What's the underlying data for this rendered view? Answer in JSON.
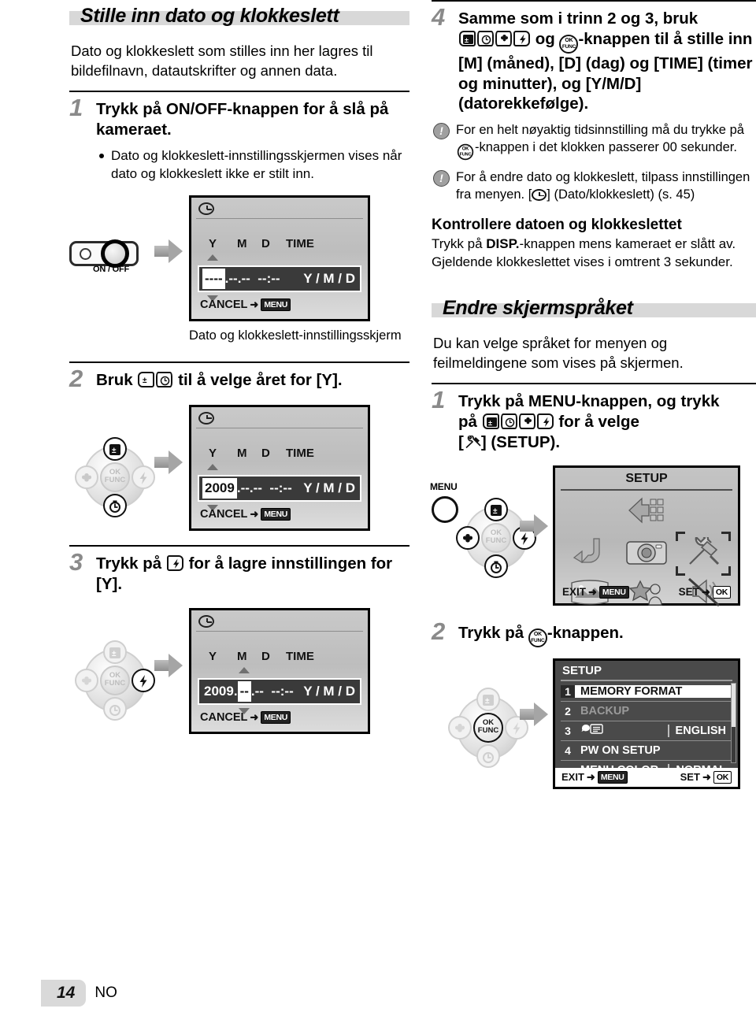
{
  "page": {
    "number": "14",
    "locale": "NO"
  },
  "left": {
    "section_title": "Stille inn dato og klokkeslett",
    "intro": "Dato og klokkeslett som stilles inn her lagres til bildefilnavn, datautskrifter og annen data.",
    "step1": {
      "num": "1",
      "text": "Trykk på ON/OFF-knappen for å slå på kameraet.",
      "bullet": "Dato og klokkeslett-innstillingsskjermen vises når dato og klokkeslett ikke er stilt inn.",
      "button_label": "ON / OFF",
      "caption": "Dato og klokkeslett-innstillingsskjerm"
    },
    "step2": {
      "num": "2",
      "text_before": "Bruk",
      "text_after": "til å velge året for [Y]."
    },
    "step3": {
      "num": "3",
      "text_before": "Trykk på",
      "text_after": "for å lagre innstillingen for [Y]."
    },
    "lcd": {
      "headers": [
        "Y",
        "M",
        "D",
        "TIME"
      ],
      "cancel_label": "CANCEL",
      "cancel_key": "MENU",
      "order": "Y / M / D",
      "screen1": {
        "year": "----",
        "month": "--",
        "day": "--",
        "hour": "--",
        "minute": "--",
        "selected": "year"
      },
      "screen2": {
        "year": "2009",
        "month": "--",
        "day": "--",
        "hour": "--",
        "minute": "--",
        "selected": "year"
      },
      "screen3": {
        "year": "2009",
        "month": "--",
        "day": "--",
        "hour": "--",
        "minute": "--",
        "selected": "month"
      }
    }
  },
  "right": {
    "step4": {
      "num": "4",
      "line1": "Samme som i trinn 2 og 3, bruk",
      "line2": "og",
      "line3": "-knappen til å stille inn [M] (måned), [D] (dag) og [TIME] (timer og minutter), og [Y/M/D] (datorekkefølge)."
    },
    "notes": [
      {
        "a": "For en helt nøyaktig tidsinnstilling må du trykke på",
        "b": "-knappen i det klokken passerer 00 sekunder."
      },
      {
        "a": "For å endre dato og klokkeslett, tilpass innstillingen fra menyen. [",
        "b": "] (Dato/klokkeslett) (s. 45)"
      }
    ],
    "check": {
      "heading": "Kontrollere datoen og klokkeslettet",
      "body_a": "Trykk på",
      "body_bold": "DISP.",
      "body_b": "-knappen mens kameraet er slått av. Gjeldende klokkeslettet vises i omtrent 3 sekunder."
    },
    "section_title": "Endre skjermspråket",
    "intro": "Du kan velge språket for menyen og feilmeldingene som vises på skjermen.",
    "step1": {
      "num": "1",
      "line1": "Trykk på MENU-knappen, og trykk",
      "line2": "på",
      "line3": "for å velge",
      "line4": "] (SETUP)."
    },
    "step2": {
      "num": "2",
      "text_before": "Trykk på",
      "text_after": "-knappen."
    },
    "menu_btn_label": "MENU",
    "setup_grid": {
      "title": "SETUP",
      "exit_label": "EXIT",
      "exit_key": "MENU",
      "set_label": "SET",
      "set_key": "OK",
      "icons": [
        "menu-cascade-icon",
        "back-arrow-icon",
        "camera-icon",
        "tools-icon",
        "panorama-icon",
        "scene-icon",
        "silent-mode-icon"
      ]
    },
    "setup_list": {
      "title": "SETUP",
      "exit_label": "EXIT",
      "exit_key": "MENU",
      "set_label": "SET",
      "set_key": "OK",
      "rows": [
        {
          "idx": "1",
          "label": "MEMORY FORMAT",
          "value": "",
          "state": "selected"
        },
        {
          "idx": "2",
          "label": "BACKUP",
          "value": "",
          "state": "dim"
        },
        {
          "idx": "3",
          "label": "",
          "value": "ENGLISH",
          "state": "normal",
          "icon": "language-icon"
        },
        {
          "idx": "4",
          "label": "PW ON SETUP",
          "value": "",
          "state": "normal"
        },
        {
          "idx": "",
          "label": "MENU COLOR",
          "value": "NORMAL",
          "state": "normal"
        }
      ]
    }
  },
  "colors": {
    "band": "#d8d8d8",
    "step_number": "#8a8a8a",
    "lcd_dark": "#3a3a3a",
    "page_tab": "#d9d9d9"
  }
}
